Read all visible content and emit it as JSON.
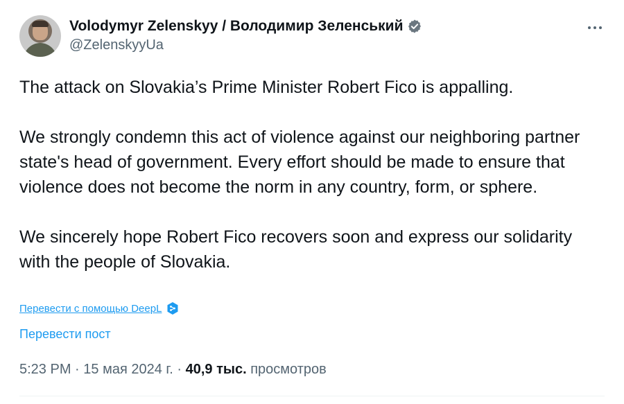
{
  "author": {
    "display_name": "Volodymyr Zelenskyy / Володимир Зеленський",
    "handle": "@ZelenskyyUa",
    "verified": true
  },
  "tweet": {
    "paragraphs": [
      "The attack on Slovakia’s Prime Minister Robert Fico is appalling.",
      "We strongly condemn this act of violence against our neighboring partner state's head of government. Every effort should be made to ensure that violence does not become the norm in any country, form, or sphere.",
      "We sincerely hope Robert Fico recovers soon and express our solidarity with the people of Slovakia."
    ],
    "translate_deepl_label": "Перевести с помощью DeepL",
    "translate_post_label": "Перевести пост",
    "time": "5:23 PM",
    "separator": "·",
    "date": "15 мая 2024 г.",
    "views_count": "40,9 тыс.",
    "views_label": "просмотров"
  },
  "colors": {
    "link": "#1d9bf0",
    "secondary_text": "#536471",
    "primary_text": "#0f1419",
    "deepl_badge": "#1d9bf0"
  },
  "icons": {
    "verified": "verified-badge-icon",
    "more": "more-dots-icon",
    "deepl": "deepl-icon"
  }
}
